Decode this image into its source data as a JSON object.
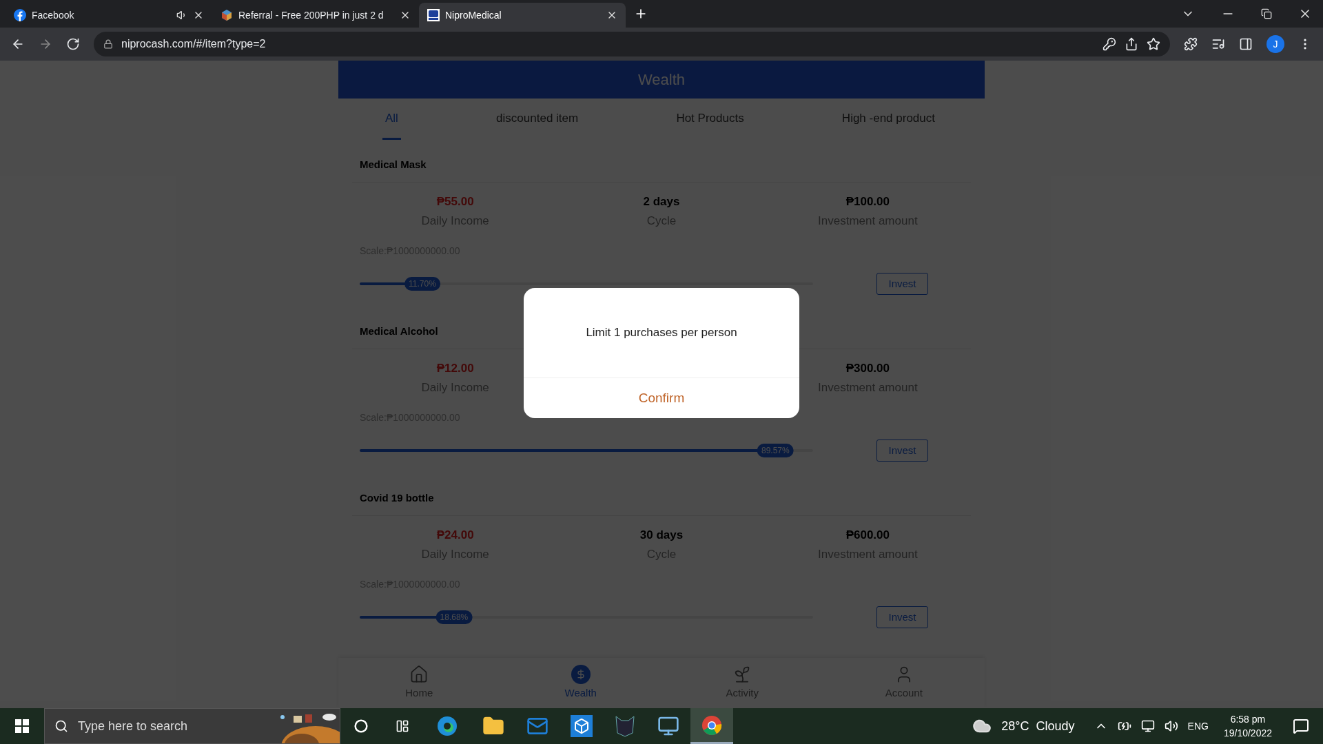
{
  "browser": {
    "tabs": [
      {
        "title": "Facebook",
        "selected": false,
        "audio": true
      },
      {
        "title": "Referral - Free 200PHP in just 2 d",
        "selected": false,
        "audio": false
      },
      {
        "title": "NiproMedical",
        "selected": true,
        "audio": false
      }
    ],
    "address": "niprocash.com/#/item?type=2",
    "profile_initial": "J"
  },
  "page": {
    "title": "Wealth",
    "tabs": [
      {
        "label": "All",
        "selected": true
      },
      {
        "label": "discounted item",
        "selected": false
      },
      {
        "label": "Hot Products",
        "selected": false
      },
      {
        "label": "High -end product",
        "selected": false
      }
    ],
    "products": [
      {
        "name": "Medical Mask",
        "daily_income": "₱55.00",
        "daily_income_label": "Daily Income",
        "cycle": "2 days",
        "cycle_label": "Cycle",
        "amount": "₱100.00",
        "amount_label": "Investment amount",
        "scale": "Scale:₱1000000000.00",
        "level": 0.117,
        "progress": "11.70%",
        "button": "Invest"
      },
      {
        "name": "Medical Alcohol",
        "daily_income": "₱12.00",
        "daily_income_label": "Daily Income",
        "amount": "₱300.00",
        "amount_label": "Investment amount",
        "scale": "Scale:₱1000000000.00",
        "level": 0.8957,
        "progress": "89.57%",
        "button": "Invest"
      },
      {
        "name": "Covid 19 bottle",
        "daily_income": "₱24.00",
        "daily_income_label": "Daily Income",
        "cycle": "30 days",
        "cycle_label": "Cycle",
        "amount": "₱600.00",
        "amount_label": "Investment amount",
        "scale": "Scale:₱1000000000.00",
        "level": 0.1868,
        "progress": "18.68%",
        "button": "Invest"
      }
    ],
    "nav": [
      {
        "label": "Home",
        "selected": false
      },
      {
        "label": "Wealth",
        "selected": true
      },
      {
        "label": "Activity",
        "selected": false
      },
      {
        "label": "Account",
        "selected": false
      }
    ],
    "dialog": {
      "message": "Limit 1 purchases per person",
      "button": "Confirm"
    }
  },
  "taskbar": {
    "search_placeholder": "Type here to search",
    "weather": "28°C  Cloudy",
    "language": "ENG",
    "time": "6:58 pm",
    "date": "19/10/2022"
  }
}
